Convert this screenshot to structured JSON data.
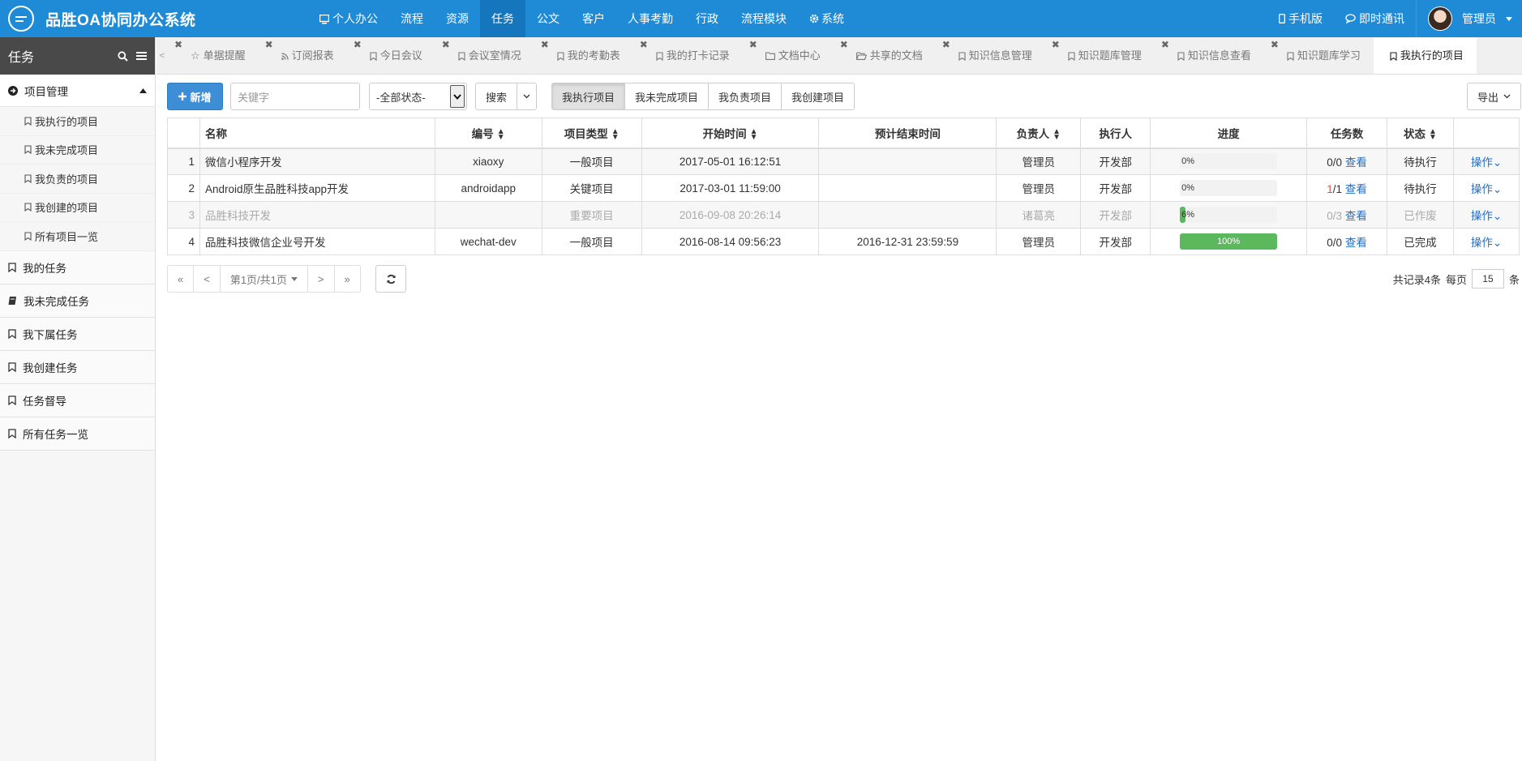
{
  "app": {
    "title": "品胜OA协同办公系统",
    "accent": "#1f8ad6"
  },
  "nav": {
    "items": [
      {
        "label": "个人办公",
        "icon": "monitor-icon"
      },
      {
        "label": "流程"
      },
      {
        "label": "资源"
      },
      {
        "label": "任务",
        "active": true
      },
      {
        "label": "公文"
      },
      {
        "label": "客户"
      },
      {
        "label": "人事考勤"
      },
      {
        "label": "行政"
      },
      {
        "label": "流程模块"
      },
      {
        "label": "系统",
        "icon": "gear-icon"
      }
    ],
    "mobile": "手机版",
    "im": "即时通讯",
    "user": "管理员"
  },
  "sidebar": {
    "title": "任务",
    "group": {
      "label": "项目管理",
      "items": [
        "我执行的项目",
        "我未完成项目",
        "我负责的项目",
        "我创建的项目",
        "所有项目一览"
      ]
    },
    "items": [
      "我的任务",
      "我未完成任务",
      "我下属任务",
      "我创建任务",
      "任务督导",
      "所有任务一览"
    ]
  },
  "tabs": [
    {
      "label": "单据提醒",
      "icon": "star-icon"
    },
    {
      "label": "订阅报表",
      "icon": "rss-icon"
    },
    {
      "label": "今日会议",
      "icon": "bookmark-icon"
    },
    {
      "label": "会议室情况",
      "icon": "bookmark-icon"
    },
    {
      "label": "我的考勤表",
      "icon": "bookmark-icon"
    },
    {
      "label": "我的打卡记录",
      "icon": "bookmark-icon"
    },
    {
      "label": "文档中心",
      "icon": "folder-icon"
    },
    {
      "label": "共享的文档",
      "icon": "folder-open-icon"
    },
    {
      "label": "知识信息管理",
      "icon": "bookmark-icon"
    },
    {
      "label": "知识题库管理",
      "icon": "bookmark-icon"
    },
    {
      "label": "知识信息查看",
      "icon": "bookmark-icon"
    },
    {
      "label": "知识题库学习",
      "icon": "bookmark-icon"
    },
    {
      "label": "我执行的项目",
      "icon": "bookmark-icon",
      "active": true
    }
  ],
  "toolbar": {
    "new_label": "新增",
    "keyword_placeholder": "关键字",
    "status_value": "-全部状态-",
    "search_label": "搜索",
    "filters": [
      "我执行项目",
      "我未完成项目",
      "我负责项目",
      "我创建项目"
    ],
    "export_label": "导出"
  },
  "table": {
    "headers": {
      "name": "名称",
      "code": "编号",
      "type": "项目类型",
      "start": "开始时间",
      "end": "预计结束时间",
      "owner": "负责人",
      "executor": "执行人",
      "progress": "进度",
      "tasks": "任务数",
      "status": "状态"
    },
    "view_label": "查看",
    "op_label": "操作",
    "rows": [
      {
        "idx": "1",
        "name": "微信小程序开发",
        "code": "xiaoxy",
        "type": "一般项目",
        "start": "2017-05-01 16:12:51",
        "end": "",
        "owner": "管理员",
        "executor": "开发部",
        "progress": 0,
        "progress_label": "0%",
        "tasks_done": "0",
        "tasks_total": "/0",
        "status": "待执行"
      },
      {
        "idx": "2",
        "name": "Android原生品胜科技app开发",
        "code": "androidapp",
        "type": "关键项目",
        "start": "2017-03-01 11:59:00",
        "end": "",
        "owner": "管理员",
        "executor": "开发部",
        "progress": 0,
        "progress_label": "0%",
        "tasks_done": "1",
        "tasks_total": "/1",
        "status": "待执行"
      },
      {
        "idx": "3",
        "name": "品胜科技开发",
        "code": "",
        "type": "重要项目",
        "start": "2016-09-08 20:26:14",
        "end": "",
        "owner": "诸葛亮",
        "executor": "开发部",
        "progress": 6,
        "progress_label": "6%",
        "tasks_done": "0",
        "tasks_total": "/3",
        "status": "已作废"
      },
      {
        "idx": "4",
        "name": "品胜科技微信企业号开发",
        "code": "wechat-dev",
        "type": "一般项目",
        "start": "2016-08-14 09:56:23",
        "end": "2016-12-31 23:59:59",
        "owner": "管理员",
        "executor": "开发部",
        "progress": 100,
        "progress_label": "100%",
        "tasks_done": "0",
        "tasks_total": "/0",
        "status": "已完成"
      }
    ]
  },
  "pager": {
    "first": "«",
    "prev": "<",
    "page_label": "第1页/共1页",
    "next": ">",
    "last": "»",
    "total_label": "共记录4条",
    "per_page_label": "每页",
    "per_page": "15",
    "unit": "条"
  }
}
